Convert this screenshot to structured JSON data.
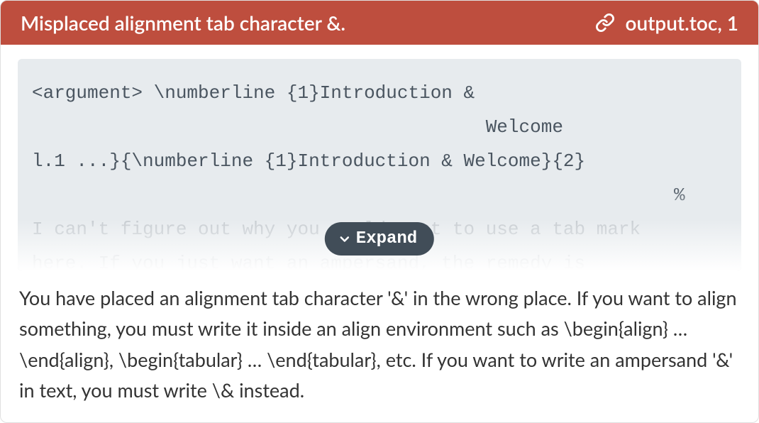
{
  "header": {
    "title": "Misplaced alignment tab character &.",
    "location": "output.toc, 1"
  },
  "code": {
    "line1": "<argument> \\numberline {1}Introduction &",
    "line2": "                                         Welcome",
    "line3": "l.1 ...}{\\numberline {1}Introduction & Welcome}{2}",
    "line4": "                                                          %",
    "line5": "I can't figure out why you would want to use a tab mark",
    "line6": "here. If you just want an ampersand, the remedy is"
  },
  "expand": {
    "label": "Expand"
  },
  "explanation": {
    "text": "You have placed an alignment tab character '&' in the wrong place. If you want to align something, you must write it inside an align environment such as \\begin{align} … \\end{align}, \\begin{tabular} … \\end{tabular}, etc. If you want to write an ampersand '&' in text, you must write \\& instead."
  }
}
